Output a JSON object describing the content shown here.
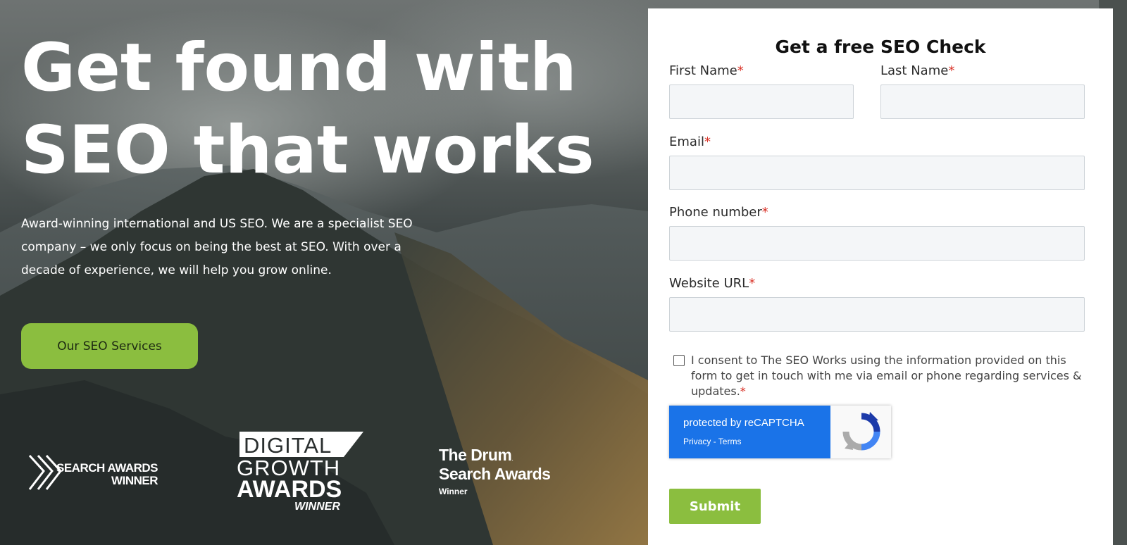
{
  "hero": {
    "headline_line1": "Get found with",
    "headline_line2": "SEO that works",
    "intro": "Award-winning international and US SEO. We are a specialist SEO company – we only focus on being the best at SEO. With over a decade of experience, we will help you grow online.",
    "cta_label": "Our SEO Services"
  },
  "awards": {
    "search_awards": {
      "line1": "SEARCH AWARDS",
      "line2": "WINNER"
    },
    "digital_growth": {
      "line1": "DIGITAL",
      "line2": "GROWTH",
      "line3": "AWARDS",
      "line4": "WINNER"
    },
    "drum": {
      "line1": "The Drum",
      "mark": ".",
      "line2": "Search Awards",
      "line3": "Winner"
    }
  },
  "form": {
    "title": "Get a free SEO Check",
    "required_mark": "*",
    "first_name": {
      "label": "First Name",
      "value": ""
    },
    "last_name": {
      "label": "Last Name",
      "value": ""
    },
    "email": {
      "label": "Email",
      "value": ""
    },
    "phone": {
      "label": "Phone number",
      "value": ""
    },
    "website": {
      "label": "Website URL",
      "value": ""
    },
    "consent": {
      "text": "I consent to The SEO Works using the information provided on this form to get in touch with me via email or phone regarding services & updates.",
      "checked": false
    },
    "recaptcha": {
      "line1": "protected by reCAPTCHA",
      "line2": "Privacy - Terms"
    },
    "submit_label": "Submit"
  },
  "colors": {
    "accent_green": "#8bbe3f",
    "recaptcha_blue": "#1a73e8",
    "required_red": "#d93025"
  },
  "icons": [
    "chevron-double-icon",
    "recaptcha-logo-icon"
  ]
}
